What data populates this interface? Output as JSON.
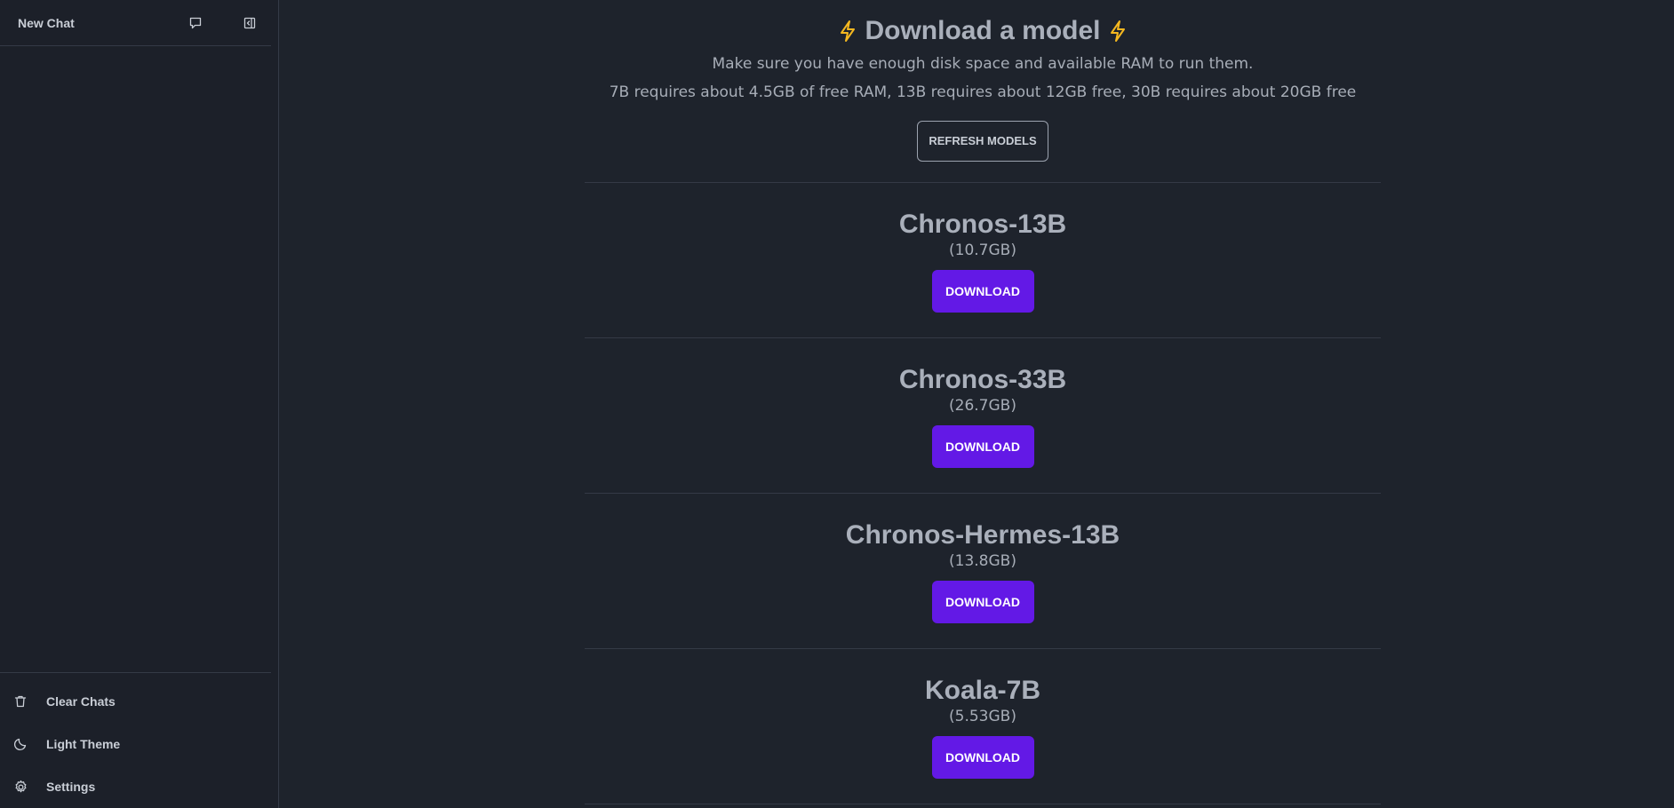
{
  "sidebar": {
    "new_chat_label": "New Chat",
    "new_chat_icon": "chat-bubble-icon",
    "collapse_icon": "sidebar-collapse-icon",
    "items": [
      {
        "label": "Clear Chats",
        "icon": "trash-icon"
      },
      {
        "label": "Light Theme",
        "icon": "moon-icon"
      },
      {
        "label": "Settings",
        "icon": "gear-icon"
      }
    ]
  },
  "main": {
    "title": "Download a model",
    "title_icon": "lightning-bolt-icon",
    "subtitle_line1": "Make sure you have enough disk space and available RAM to run them.",
    "subtitle_line2": "7B requires about 4.5GB of free RAM, 13B requires about 12GB free, 30B requires about 20GB free",
    "refresh_label": "REFRESH MODELS",
    "models": [
      {
        "name": "Chronos-13B",
        "size": "(10.7GB)",
        "button": "DOWNLOAD"
      },
      {
        "name": "Chronos-33B",
        "size": "(26.7GB)",
        "button": "DOWNLOAD"
      },
      {
        "name": "Chronos-Hermes-13B",
        "size": "(13.8GB)",
        "button": "DOWNLOAD"
      },
      {
        "name": "Koala-7B",
        "size": "(5.53GB)",
        "button": "DOWNLOAD"
      }
    ]
  },
  "colors": {
    "background": "#1e232c",
    "sidebar": "#1c2029",
    "accent": "#6319e6",
    "bolt": "#f5b820"
  }
}
